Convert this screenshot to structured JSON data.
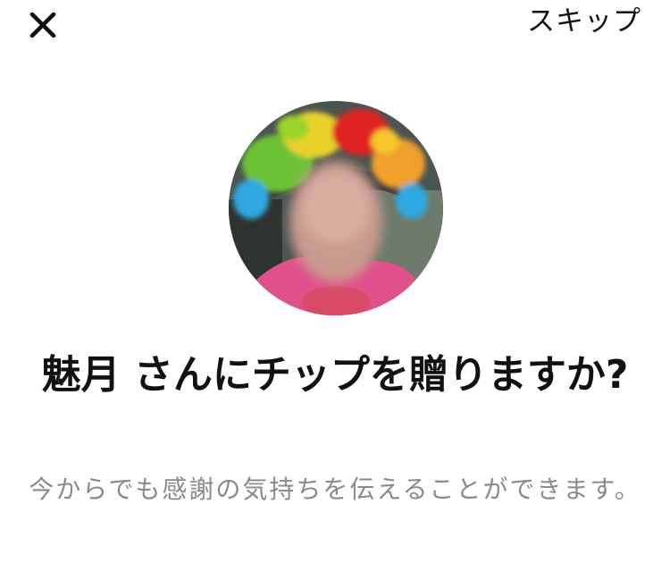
{
  "header": {
    "close_icon": "close-icon",
    "skip_label": "スキップ"
  },
  "recipient": {
    "avatar_alt": "魅月"
  },
  "dialog": {
    "title": "魅月 さんにチップを贈りますか?",
    "subtitle": "今からでも感謝の気持ちを伝えることができます。"
  },
  "colors": {
    "text_primary": "#111111",
    "text_secondary": "#8a8a8a",
    "background": "#ffffff"
  }
}
